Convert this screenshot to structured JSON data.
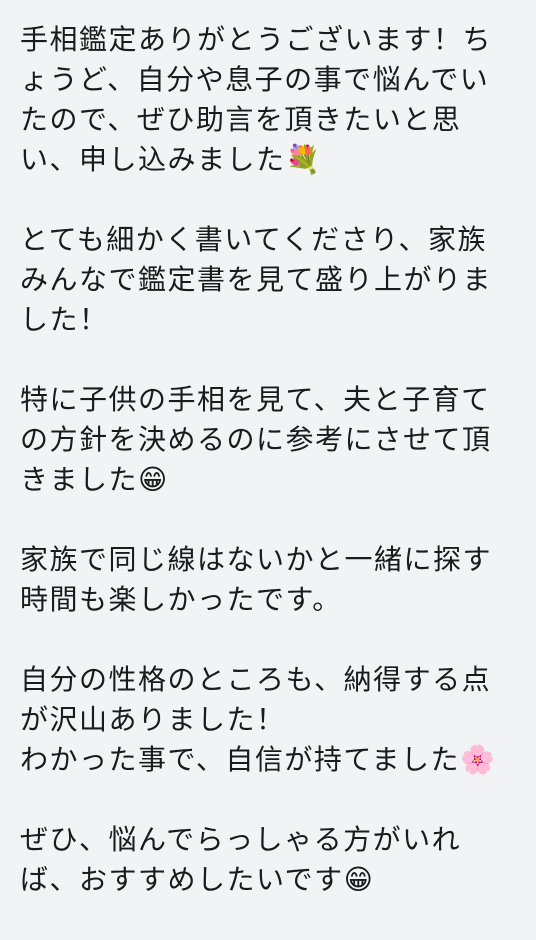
{
  "message": {
    "paragraphs": [
      {
        "lines": [
          "手相鑑定ありがとうございます！ち",
          "ょうど、自分や息子の事で悩んでい",
          "たので、ぜひ助言を頂きたいと思",
          "い、申し込みました💐"
        ]
      },
      {
        "lines": [
          "とても細かく書いてくださり、家族",
          "みんなで鑑定書を見て盛り上がりま",
          "した！"
        ]
      },
      {
        "lines": [
          "特に子供の手相を見て、夫と子育て",
          "の方針を決めるのに参考にさせて頂",
          "きました😁"
        ]
      },
      {
        "lines": [
          "家族で同じ線はないかと一緒に探す",
          "時間も楽しかったです。"
        ]
      },
      {
        "lines": [
          "自分の性格のところも、納得する点",
          "が沢山ありました！",
          "わかった事で、自信が持てました🌸"
        ]
      },
      {
        "lines": [
          "ぜひ、悩んでらっしゃる方がいれ",
          "ば、おすすめしたいです😁"
        ]
      }
    ]
  }
}
